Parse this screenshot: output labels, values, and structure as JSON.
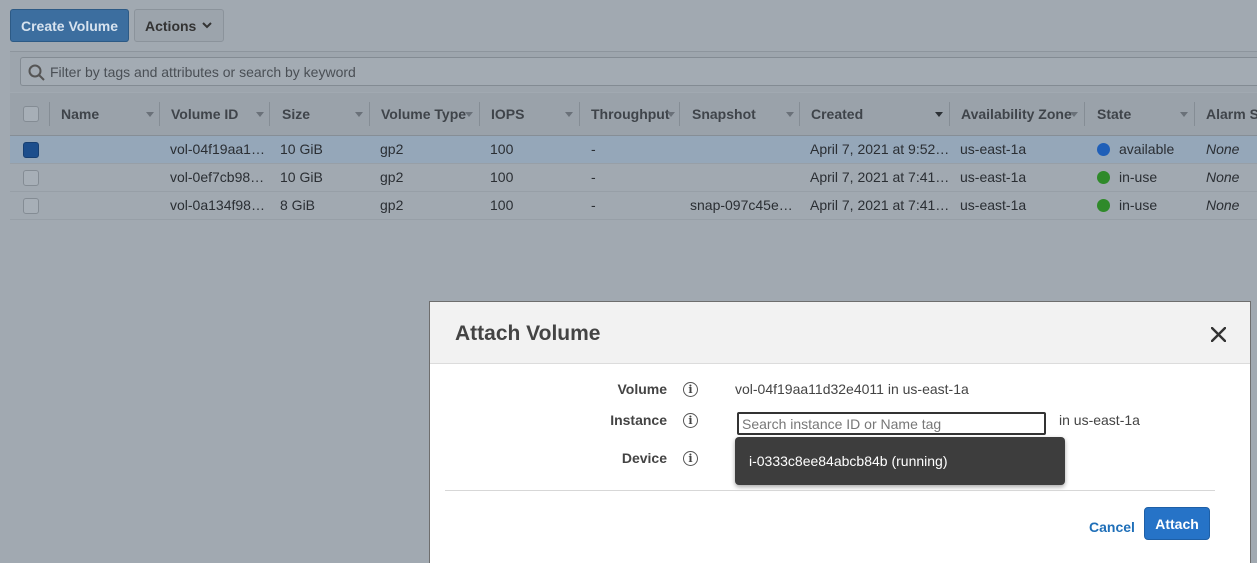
{
  "toolbar": {
    "create_volume_label": "Create Volume",
    "actions_label": "Actions"
  },
  "filter": {
    "placeholder": "Filter by tags and attributes or search by keyword"
  },
  "table": {
    "columns": [
      "Name",
      "Volume ID",
      "Size",
      "Volume Type",
      "IOPS",
      "Throughput",
      "Snapshot",
      "Created",
      "Availability Zone",
      "State",
      "Alarm St"
    ],
    "rows": [
      {
        "selected": true,
        "name": "",
        "volume_id": "vol-04f19aa1…",
        "size": "10 GiB",
        "volume_type": "gp2",
        "iops": "100",
        "throughput": "-",
        "snapshot": "",
        "created": "April 7, 2021 at 9:52…",
        "availability_zone": "us-east-1a",
        "state": "available",
        "state_color": "#1f5fb8",
        "alarm": "None"
      },
      {
        "selected": false,
        "name": "",
        "volume_id": "vol-0ef7cb98…",
        "size": "10 GiB",
        "volume_type": "gp2",
        "iops": "100",
        "throughput": "-",
        "snapshot": "",
        "created": "April 7, 2021 at 7:41…",
        "availability_zone": "us-east-1a",
        "state": "in-use",
        "state_color": "#2f8a2a",
        "alarm": "None"
      },
      {
        "selected": false,
        "name": "",
        "volume_id": "vol-0a134f98…",
        "size": "8 GiB",
        "volume_type": "gp2",
        "iops": "100",
        "throughput": "-",
        "snapshot": "snap-097c45e…",
        "created": "April 7, 2021 at 7:41…",
        "availability_zone": "us-east-1a",
        "state": "in-use",
        "state_color": "#2f8a2a",
        "alarm": "None"
      }
    ]
  },
  "modal": {
    "title": "Attach Volume",
    "volume_label": "Volume",
    "volume_value": "vol-04f19aa11d32e4011 in us-east-1a",
    "instance_label": "Instance",
    "instance_placeholder": "Search instance ID or Name tag",
    "instance_suffix": "in us-east-1a",
    "device_label": "Device",
    "dropdown_option": "i-0333c8ee84abcb84b (running)",
    "cancel_label": "Cancel",
    "attach_label": "Attach"
  },
  "colors": {
    "primary_button": "#3c6e9f",
    "attach_button": "#2673c7",
    "link": "#1f6fb8",
    "available": "#1f5fb8",
    "in_use": "#2f8a2a"
  }
}
